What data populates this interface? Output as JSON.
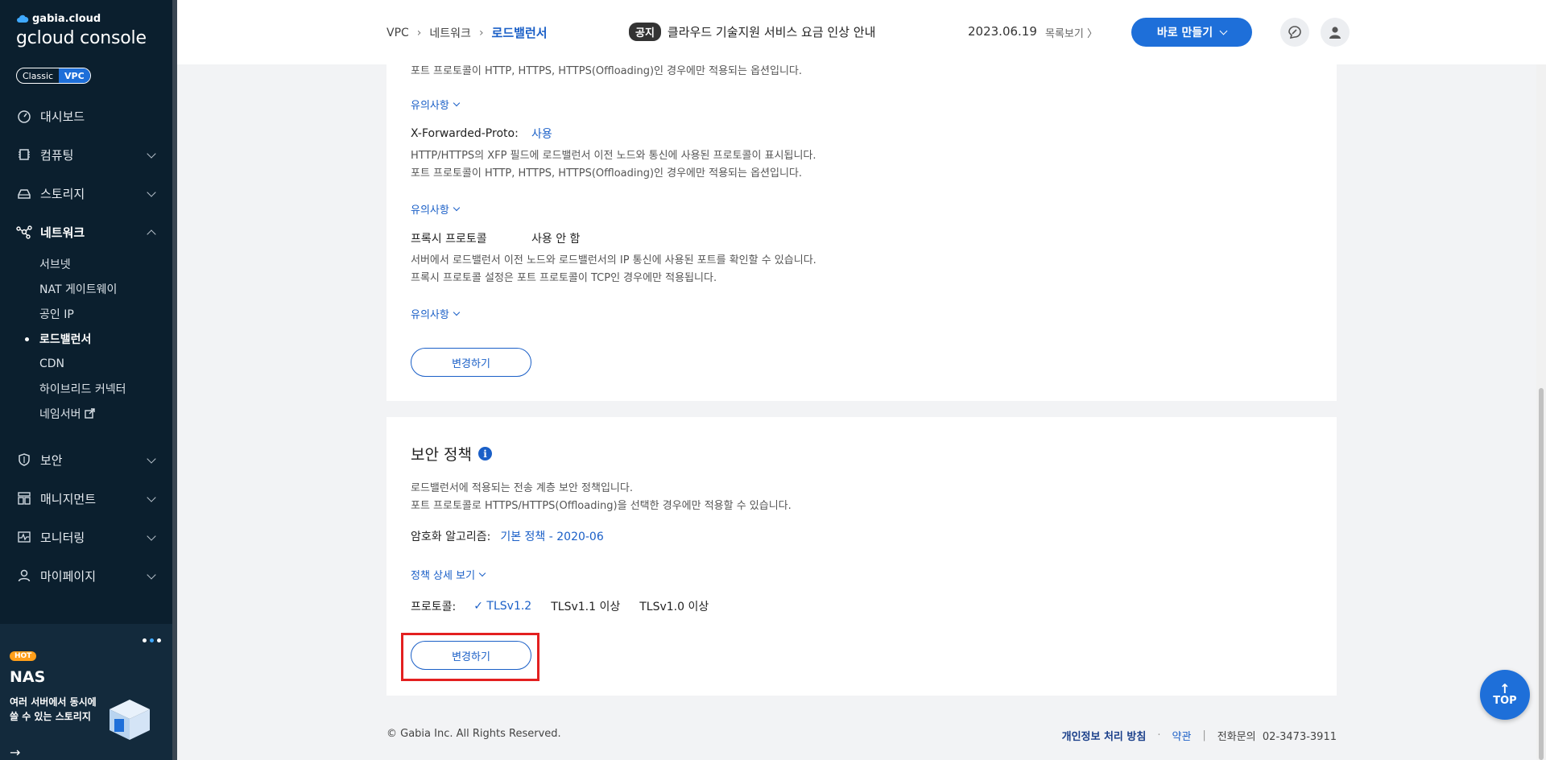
{
  "brand": {
    "top": "gabia.cloud",
    "bottom": "gcloud console"
  },
  "env_toggle": {
    "classic": "Classic",
    "vpc": "VPC"
  },
  "sidebar": {
    "items": [
      {
        "label": "대시보드"
      },
      {
        "label": "컴퓨팅"
      },
      {
        "label": "스토리지"
      },
      {
        "label": "네트워크"
      },
      {
        "label": "보안"
      },
      {
        "label": "매니지먼트"
      },
      {
        "label": "모니터링"
      },
      {
        "label": "마이페이지"
      }
    ],
    "network_sub": [
      {
        "label": "서브넷"
      },
      {
        "label": "NAT 게이트웨이"
      },
      {
        "label": "공인 IP"
      },
      {
        "label": "로드밸런서"
      },
      {
        "label": "CDN"
      },
      {
        "label": "하이브리드 커넥터"
      },
      {
        "label": "네임서버"
      }
    ]
  },
  "promo": {
    "badge": "HOT",
    "title": "NAS",
    "desc": "여러 서버에서 동시에 쓸 수 있는 스토리지",
    "arrow": "→"
  },
  "header": {
    "breadcrumb": [
      "VPC",
      "네트워크",
      "로드밸런서"
    ],
    "breadcrumb_sep": "›",
    "notice_badge": "공지",
    "notice_text": "클라우드 기술지원 서비스 요금 인상 안내",
    "notice_date": "2023.06.19",
    "notice_list": "목록보기 〉",
    "create_label": "바로 만들기"
  },
  "card1": {
    "top_desc": "포트 프로토콜이 HTTP, HTTPS, HTTPS(Offloading)인 경우에만 적용되는 옵션입니다.",
    "caution": "유의사항",
    "xfp_label": "X-Forwarded-Proto:",
    "xfp_value": "사용",
    "xfp_desc1": "HTTP/HTTPS의 XFP 필드에 로드밸런서 이전 노드와 통신에 사용된 프로토콜이 표시됩니다.",
    "xfp_desc2": "포트 프로토콜이 HTTP, HTTPS, HTTPS(Offloading)인 경우에만 적용되는 옵션입니다.",
    "proxy_label": "프록시 프로토콜",
    "proxy_value": "사용 안 함",
    "proxy_desc1": "서버에서 로드밸런서 이전 노드와 로드밸런서의 IP 통신에 사용된 포트를 확인할 수 있습니다.",
    "proxy_desc2": "프록시 프로토콜 설정은 포트 프로토콜이 TCP인 경우에만 적용됩니다.",
    "change_label": "변경하기"
  },
  "card2": {
    "title": "보안 정책",
    "info": "i",
    "desc1": "로드밸런서에 적용되는 전송 계층 보안 정책입니다.",
    "desc2": "포트 프로토콜로 HTTPS/HTTPS(Offloading)을 선택한 경우에만 적용할 수 있습니다.",
    "algo_label": "암호화 알고리즘:",
    "algo_value": "기본 정책 - 2020-06",
    "detail_link": "정책 상세 보기",
    "protocol_label": "프로토콜:",
    "protocols": [
      "✓ TLSv1.2",
      "TLSv1.1 이상",
      "TLSv1.0 이상"
    ],
    "change_label": "변경하기"
  },
  "footer": {
    "copyright": "© Gabia Inc. All Rights Reserved.",
    "privacy": "개인정보 처리 방침",
    "dot": "·",
    "terms": "약관",
    "divider": "|",
    "phone": "전화문의  02-3473-3911"
  },
  "top_btn": {
    "arrow": "↑",
    "label": "TOP"
  },
  "colors": {
    "accent": "#1e6fd9",
    "sidebar_bg": "#0b1f2e",
    "highlight": "#e32020"
  }
}
